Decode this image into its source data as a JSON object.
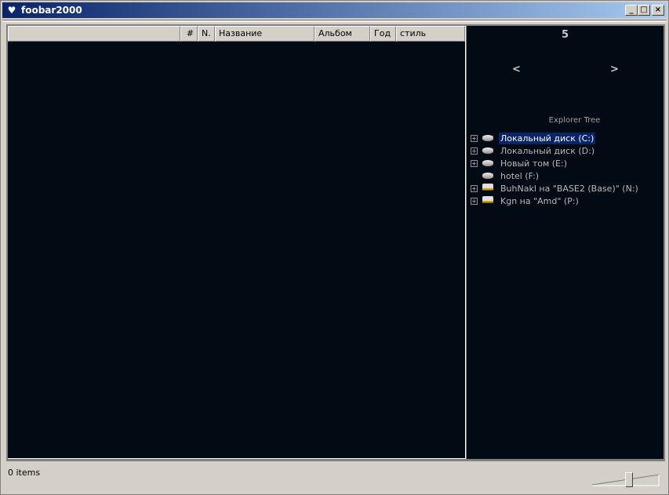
{
  "window": {
    "title": "foobar2000",
    "minimize": "_",
    "maximize": "□",
    "close": "×"
  },
  "playlist": {
    "columns": [
      "",
      "#",
      "N.",
      "Название",
      "Альбом",
      "Год",
      "стиль"
    ]
  },
  "panel": {
    "number": "5",
    "prev": "<",
    "next": ">",
    "explorer_title": "Explorer Tree",
    "tree": [
      {
        "label": "Локальный диск (C:)",
        "type": "drive",
        "expandable": true,
        "selected": true
      },
      {
        "label": "Локальный диск (D:)",
        "type": "drive",
        "expandable": true
      },
      {
        "label": "Новый том (E:)",
        "type": "drive",
        "expandable": true
      },
      {
        "label": "hotel (F:)",
        "type": "drive",
        "expandable": false
      },
      {
        "label": "BuhNakl на \"BASE2 (Base)\" (N:)",
        "type": "network",
        "expandable": true
      },
      {
        "label": "Kgn на \"Amd\" (P:)",
        "type": "network",
        "expandable": true
      }
    ]
  },
  "status": {
    "text": "0 items",
    "volume": 0.55
  }
}
